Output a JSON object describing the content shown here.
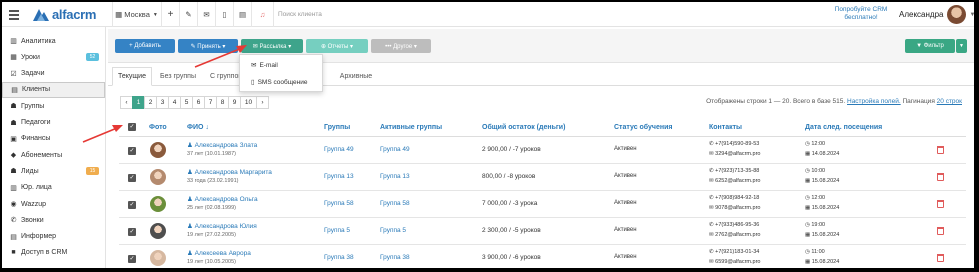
{
  "topbar": {
    "logo_text": "alfacrm",
    "branch": "Москва",
    "search_placeholder": "Поиск клиента",
    "promo": "Попробуйте CRM бесплатно!",
    "user_name": "Александра"
  },
  "sidebar": {
    "items": [
      {
        "label": "Аналитика",
        "icon": "chart-icon"
      },
      {
        "label": "Уроки",
        "icon": "calendar-icon",
        "badge": "52",
        "badge_color": "#5bc0de"
      },
      {
        "label": "Задачи",
        "icon": "tasks-icon"
      },
      {
        "label": "Клиенты",
        "icon": "clients-icon"
      },
      {
        "label": "Группы",
        "icon": "groups-icon"
      },
      {
        "label": "Педагоги",
        "icon": "teacher-icon"
      },
      {
        "label": "Финансы",
        "icon": "finance-icon"
      },
      {
        "label": "Абонементы",
        "icon": "tag-icon"
      },
      {
        "label": "Лиды",
        "icon": "leads-icon",
        "badge": "15",
        "badge_color": "#f0ad4e"
      },
      {
        "label": "Юр. лица",
        "icon": "building-icon"
      },
      {
        "label": "Wazzup",
        "icon": "chat-icon"
      },
      {
        "label": "Звонки",
        "icon": "phone-icon"
      },
      {
        "label": "Информер",
        "icon": "informer-icon"
      },
      {
        "label": "Доступ в CRM",
        "icon": "lock-icon"
      }
    ]
  },
  "actions": {
    "add": "+ Добавить",
    "apply": "✎ Принять ▾",
    "mailing": "✉ Рассылка ▾",
    "reports": "⊕ Отчеты ▾",
    "other": "••• Другое ▾",
    "filter": "▼ Фильтр",
    "mailing_menu": [
      "E-mail",
      "SMS сообщение"
    ]
  },
  "tabs": [
    "Текущие",
    "Без группы",
    "С группой",
    "Архивные"
  ],
  "pager": {
    "prev": "‹",
    "pages": [
      "1",
      "2",
      "3",
      "4",
      "5",
      "6",
      "7",
      "8",
      "9",
      "10"
    ],
    "next": "›",
    "info": "Отображены строки 1 — 20. Всего в базе 515.",
    "settings_link": "Настройка полей.",
    "pagination_label": "Пагинация",
    "pagination_value": "20 строк"
  },
  "table": {
    "headers": [
      "Фото",
      "ФИО ↓",
      "Группы",
      "Активные группы",
      "Общий остаток (деньги)",
      "Статус обучения",
      "Контакты",
      "Дата след. посещения"
    ],
    "rows": [
      {
        "name": "Александрова Злата",
        "age": "37 лет (10.01.1987)",
        "group": "Группа 49",
        "active": "Группа 49",
        "balance": "2 900,00 / -7 уроков",
        "status": "Активен",
        "phone": "+7(914)590-89-53",
        "email": "3294@alfacrm.pro",
        "time": "12:00",
        "date": "14.08.2024"
      },
      {
        "name": "Александрова Маргарита",
        "age": "33 года (23.02.1991)",
        "group": "Группа 13",
        "active": "Группа 13",
        "balance": "800,00 / -8 уроков",
        "status": "Активен",
        "phone": "+7(923)713-35-88",
        "email": "6252@alfacrm.pro",
        "time": "10:00",
        "date": "15.08.2024"
      },
      {
        "name": "Александрова Ольга",
        "age": "25 лет (02.08.1999)",
        "group": "Группа 58",
        "active": "Группа 58",
        "balance": "7 000,00 / -3 урока",
        "status": "Активен",
        "phone": "+7(908)984-92-18",
        "email": "9078@alfacrm.pro",
        "time": "12:00",
        "date": "15.08.2024"
      },
      {
        "name": "Александрова Юлия",
        "age": "19 лет (27.02.2005)",
        "group": "Группа 5",
        "active": "Группа 5",
        "balance": "2 300,00 / -5 уроков",
        "status": "Активен",
        "phone": "+7(933)486-95-36",
        "email": "2762@alfacrm.pro",
        "time": "19:00",
        "date": "15.08.2024"
      },
      {
        "name": "Алексеева Аврора",
        "age": "19 лет (10.05.2005)",
        "group": "Группа 38",
        "active": "Группа 38",
        "balance": "3 900,00 / -6 уроков",
        "status": "Активен",
        "phone": "+7(921)183-01-34",
        "email": "6599@alfacrm.pro",
        "time": "11:00",
        "date": "15.08.2024"
      }
    ]
  },
  "colors": {
    "primary": "#3583c5",
    "green": "#3ea48b",
    "link": "#2a7ab8",
    "annotation": "#e53935"
  }
}
